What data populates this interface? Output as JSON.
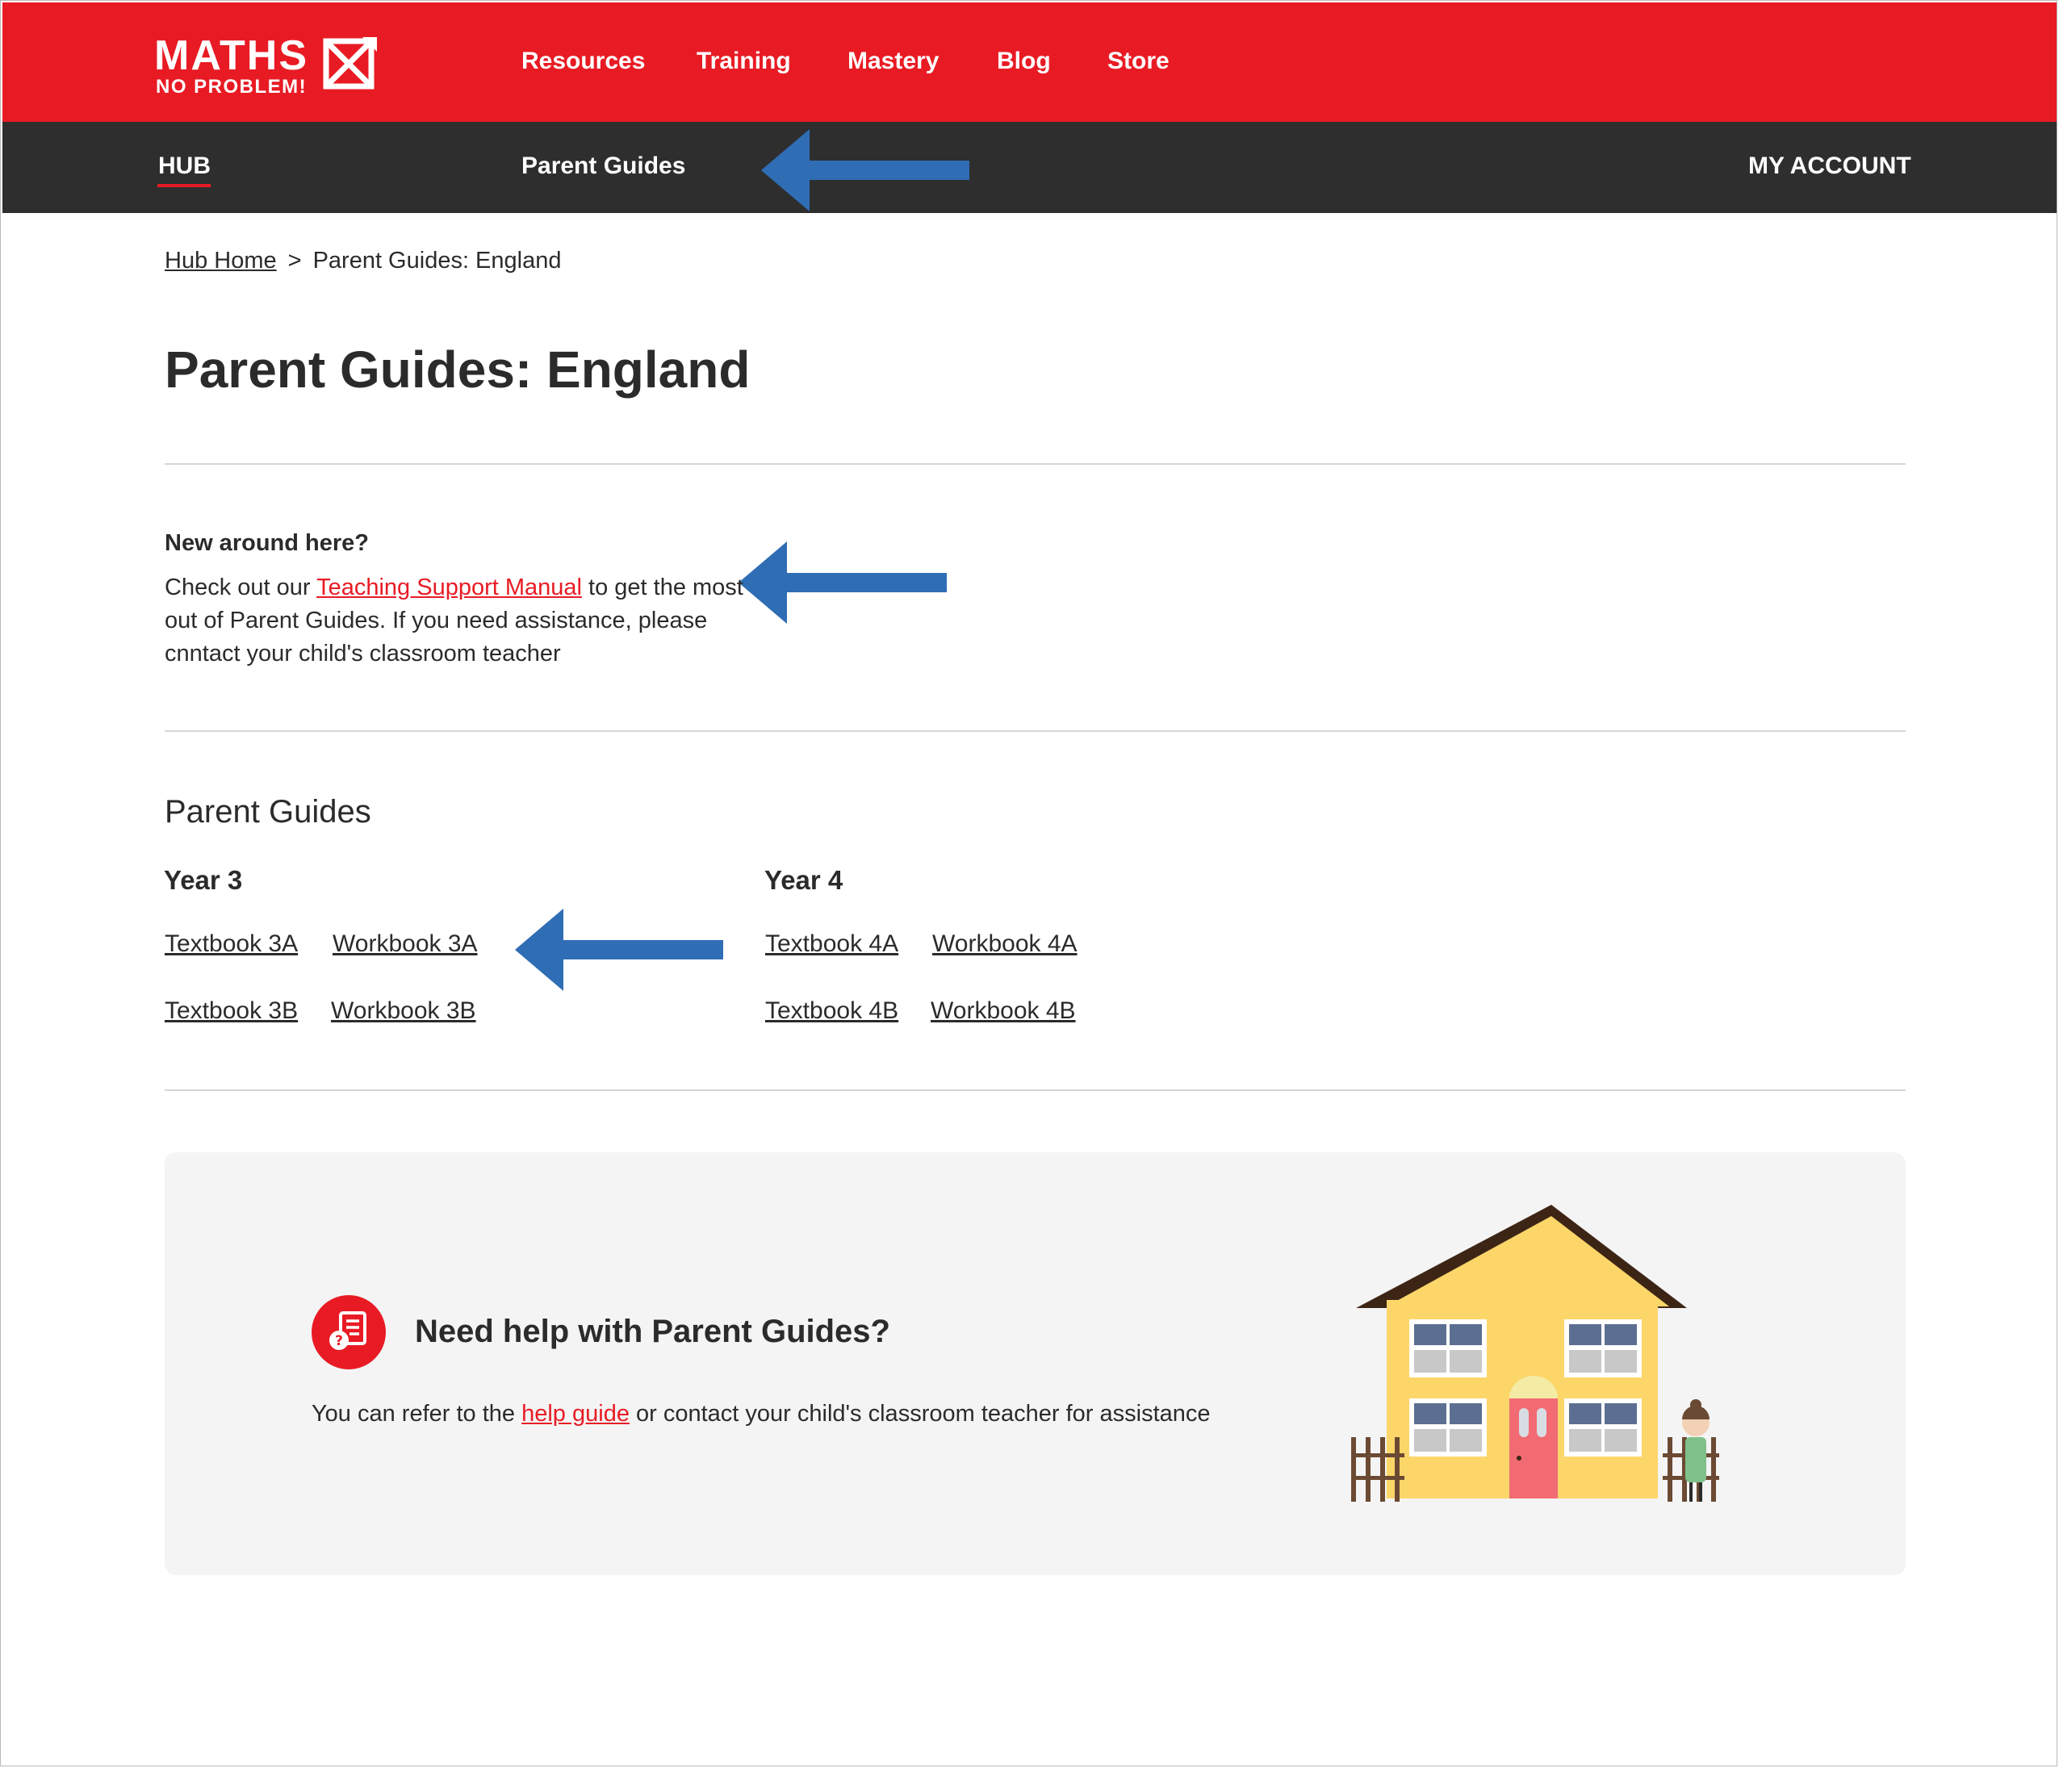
{
  "header": {
    "logo": {
      "main": "MATHS",
      "sub": "NO PROBLEM!"
    },
    "nav": [
      "Resources",
      "Training",
      "Mastery",
      "Blog",
      "Store"
    ]
  },
  "subnav": {
    "hub": "HUB",
    "parent_guides": "Parent Guides",
    "account": "MY ACCOUNT"
  },
  "breadcrumb": {
    "home": "Hub Home",
    "separator": ">",
    "current": "Parent Guides: England"
  },
  "page_title": "Parent Guides: England",
  "intro": {
    "heading": "New around here?",
    "text_before": "Check out our ",
    "link": "Teaching Support Manual",
    "text_after": " to get the most out of Parent Guides. If you need assistance, please cnntact your child's classroom teacher"
  },
  "guides": {
    "title": "Parent Guides",
    "years": [
      {
        "title": "Year 3",
        "links": [
          "Textbook 3A",
          "Workbook 3A",
          "Textbook 3B",
          "Workbook 3B"
        ]
      },
      {
        "title": "Year 4",
        "links": [
          "Textbook 4A",
          "Workbook 4A",
          "Textbook 4B",
          "Workbook 4B"
        ]
      }
    ]
  },
  "help": {
    "title": "Need help with Parent Guides?",
    "text_before": "You can refer to the ",
    "link": "help guide",
    "text_after": " or contact your child's classroom teacher for assistance"
  },
  "colors": {
    "brand_red": "#e81b24",
    "subnav_dark": "#2e2e2e",
    "annotation_arrow": "#2f6db5",
    "help_bg": "#f4f4f4"
  },
  "icons": [
    "maths-logo-icon",
    "annotation-arrow-icon",
    "help-question-icon",
    "house-illustration"
  ]
}
